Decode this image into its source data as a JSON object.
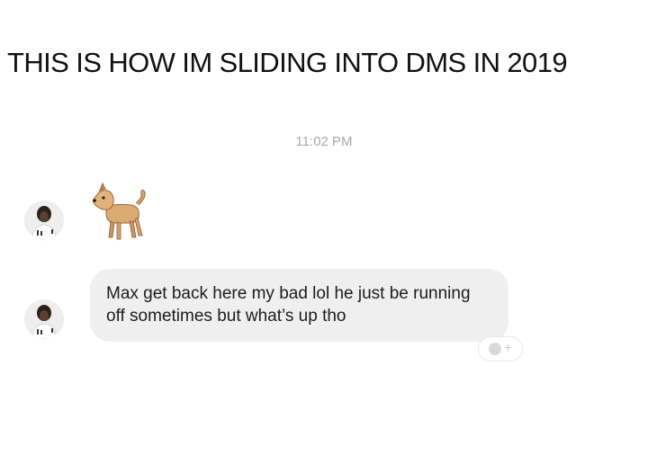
{
  "caption": "THIS IS HOW IM SLIDING INTO DMS IN 2019",
  "conversation": {
    "timestamp": "11:02 PM",
    "messages": [
      {
        "sender_avatar": "avatar-icon",
        "type": "emoji",
        "content": "dog-emoji"
      },
      {
        "sender_avatar": "avatar-icon",
        "type": "text",
        "content": "Max get back here my bad lol he just be running off sometimes but what’s up tho"
      }
    ],
    "reaction_button": {
      "icon": "add-reaction-icon",
      "plus": "+"
    }
  }
}
